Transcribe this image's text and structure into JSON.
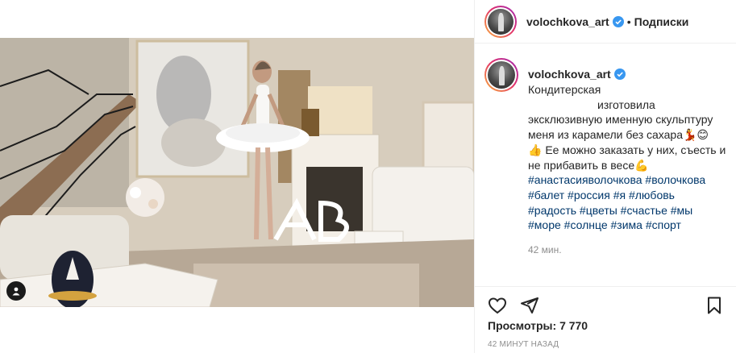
{
  "header": {
    "username": "volochkova_art",
    "separator": "•",
    "follow_label": "Подписки"
  },
  "caption": {
    "username": "volochkova_art",
    "lines": [
      "Кондитерская",
      "изготовила",
      "эксклюзивную именную скульптуру",
      "меня из карамели без сахара💃😊",
      "👍 Ее можно заказать у них, съесть и",
      "не прибавить в весе💪"
    ],
    "hashtags": [
      "#анастасияволочкова #волочкова",
      "#балет #россия #я #любовь",
      "#радость #цветы #счастье #мы",
      "#море #солнце #зима #спорт"
    ],
    "time": "42 мин."
  },
  "stats": {
    "views_label": "Просмотры:",
    "views_value": "7 770",
    "timestamp": "42 минут назад"
  },
  "icons": {
    "like": "heart-icon",
    "share": "share-icon",
    "save": "bookmark-icon",
    "verified": "verified-badge-icon",
    "tagged_user": "user-tag-icon"
  },
  "colors": {
    "verified": "#3897f0",
    "hashtag": "#00376b",
    "muted": "#8e8e8e",
    "text": "#262626"
  }
}
